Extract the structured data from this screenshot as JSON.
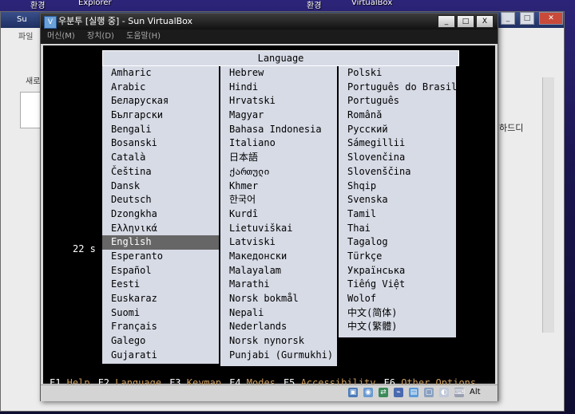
{
  "desktop": {
    "labels": [
      "환경",
      "Explorer",
      "환경",
      "VirtualBox"
    ]
  },
  "background_window": {
    "title": "Su",
    "menu": "파일",
    "new_label": "새로",
    "right_text": "하드디"
  },
  "window": {
    "title": "우분투 [실행 중] - Sun VirtualBox",
    "menu": [
      "머신(M)",
      "장치(D)",
      "도움말(H)"
    ],
    "controls": [
      "_",
      "□",
      "X"
    ]
  },
  "language_menu": {
    "header": "Language",
    "timer": "22 s",
    "selected": "English",
    "columns": [
      [
        "Amharic",
        "Arabic",
        "Беларуская",
        "Български",
        "Bengali",
        "Bosanski",
        "Català",
        "Čeština",
        "Dansk",
        "Deutsch",
        "Dzongkha",
        "Ελληνικά",
        "English",
        "Esperanto",
        "Español",
        "Eesti",
        "Euskaraz",
        "Suomi",
        "Français",
        "Galego",
        "Gujarati"
      ],
      [
        "Hebrew",
        "Hindi",
        "Hrvatski",
        "Magyar",
        "Bahasa Indonesia",
        "Italiano",
        "日本語",
        "ქართული",
        "Khmer",
        "한국어",
        "Kurdî",
        "Lietuviškai",
        "Latviski",
        "Македонски",
        "Malayalam",
        "Marathi",
        "Norsk bokmål",
        "Nepali",
        "Nederlands",
        "Norsk nynorsk",
        "Punjabi (Gurmukhi)"
      ],
      [
        "Polski",
        "Português do Brasil",
        "Português",
        "Română",
        "Русский",
        "Sámegillii",
        "Slovenčina",
        "Slovenščina",
        "Shqip",
        "Svenska",
        "Tamil",
        "Thai",
        "Tagalog",
        "Türkçe",
        "Українська",
        "Tiếng Việt",
        "Wolof",
        "中文(简体)",
        "中文(繁體)"
      ]
    ]
  },
  "function_keys": [
    {
      "key": "F1",
      "label": "Help"
    },
    {
      "key": "F2",
      "label": "Language"
    },
    {
      "key": "F3",
      "label": "Keymap"
    },
    {
      "key": "F4",
      "label": "Modes"
    },
    {
      "key": "F5",
      "label": "Accessibility"
    },
    {
      "key": "F6",
      "label": "Other Options"
    }
  ],
  "statusbar": {
    "icons": [
      "hard-disk-icon",
      "cd-icon",
      "network-icon",
      "usb-icon",
      "shared-folder-icon",
      "capture-icon",
      "mouse-icon",
      "keyboard-icon"
    ],
    "host_key": "Alt"
  }
}
